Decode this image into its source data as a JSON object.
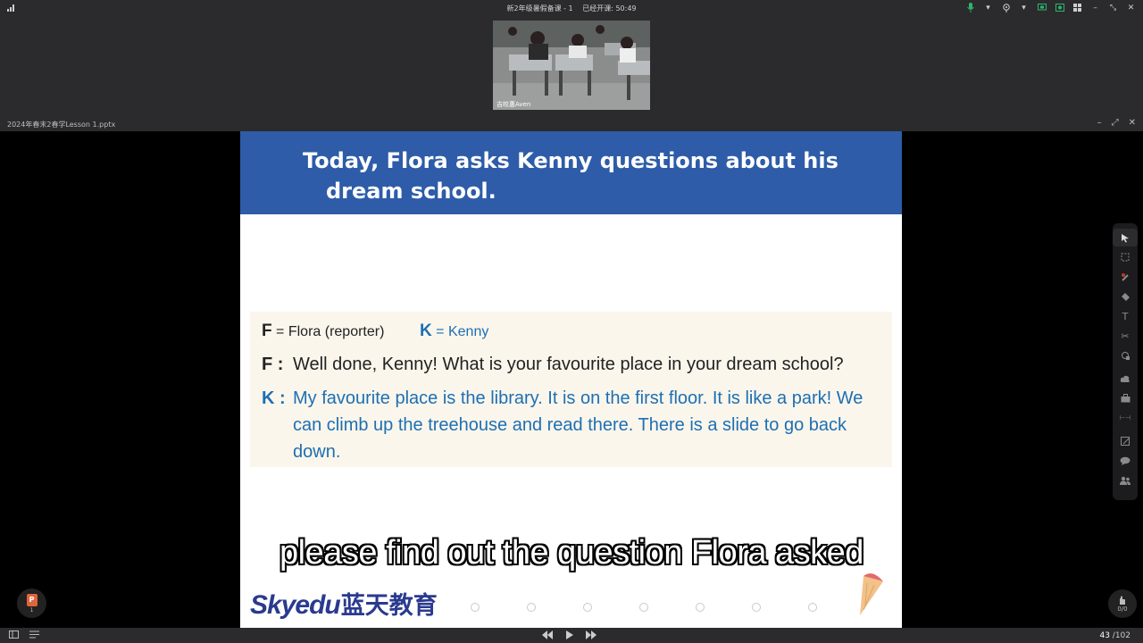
{
  "topbar": {
    "title": "新2年级暑假备课 - 1",
    "elapsed": "已经开课: 50:49"
  },
  "video": {
    "name": "吉皎惠Aven"
  },
  "document": {
    "filename": "2024年春末2春学Lesson 1.pptx"
  },
  "slide": {
    "header_line1": "Today, Flora asks Kenny questions about his",
    "header_line2": "dream school.",
    "legend_f_letter": "F",
    "legend_f_text": " = Flora (reporter)",
    "legend_k_letter": "K",
    "legend_k_text": " = Kenny",
    "speaker_f": "F :",
    "speaker_k": "K :",
    "utterance_f": "Well done, Kenny! What is your favourite place in your dream school?",
    "utterance_k": "My favourite place is the library. It is on the first floor. It is like a park! We can climb up the treehouse and read there. There is a slide to go back down.",
    "logo_latin": "Skyedu",
    "logo_cn": "蓝天教育",
    "colors": {
      "header_bg": "#2e5ca8",
      "kenny_blue": "#1e6fb3",
      "logo": "#2a3a8f"
    }
  },
  "subtitle": "please find out the question Flora asked",
  "thumbnail": {
    "badge": "P",
    "number": "1"
  },
  "hand_raise": {
    "count": "0/0"
  },
  "pager": {
    "current": "43",
    "total": " /102"
  },
  "icons": {
    "toolbar": [
      "cursor-icon",
      "marquee-select-icon",
      "laser-pointer-icon",
      "eraser-icon",
      "text-icon",
      "scissors-icon",
      "shape-icon",
      "cloud-icon",
      "toolbox-icon",
      "ruler-icon",
      "edit-icon",
      "chat-icon",
      "people-icon"
    ]
  }
}
